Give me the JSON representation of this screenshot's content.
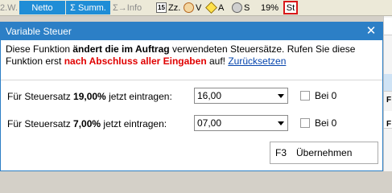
{
  "toolbar": {
    "item_partial": "2.W.",
    "item_netto": "Netto",
    "item_summ": "Σ Summ.",
    "item_info": "Σ→Info",
    "item_zz": "Zz.",
    "item_v": "V",
    "item_a": "A",
    "item_s": "S",
    "item_pct": "19%",
    "item_st": "St"
  },
  "dialog": {
    "title": "Variable Steuer",
    "info": {
      "t1": "Diese Funktion ",
      "b1": "ändert die im Auftrag",
      "t2": " verwendeten Steuersätze. Rufen Sie diese Funktion erst ",
      "r1": "nach Abschluss aller Eingaben",
      "t3": " auf! ",
      "link": "Zurücksetzen"
    },
    "rows": [
      {
        "pre": "Für Steuersatz ",
        "rate": "19,00%",
        "post": " jetzt eintragen:",
        "value": "16,00",
        "checkbox_label": "Bei 0"
      },
      {
        "pre": "Für Steuersatz ",
        "rate": "7,00%",
        "post": " jetzt eintragen:",
        "value": "07,00",
        "checkbox_label": "Bei 0"
      }
    ],
    "button": {
      "key": "F3",
      "label": "Übernehmen"
    }
  },
  "background": {
    "strip_chars": [
      "F",
      "F"
    ]
  },
  "colors": {
    "title_bg": "#2c7fc6",
    "toolbar_blue": "#1f8dd6",
    "warning_red": "#e00000",
    "link": "#0645ad",
    "highlight_border": "#d8181a"
  }
}
